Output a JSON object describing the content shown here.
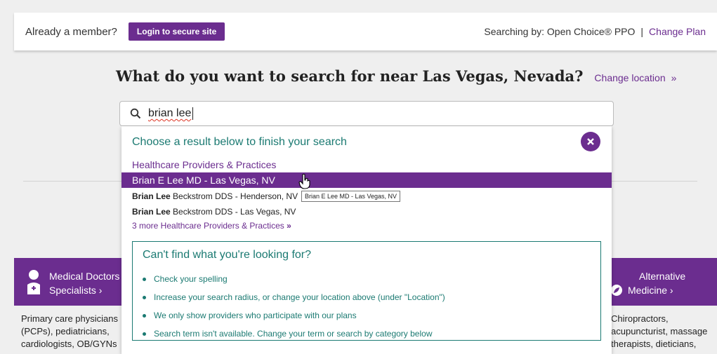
{
  "top_bar": {
    "member_label": "Already a member?",
    "login_button": "Login to secure site",
    "searching_label": "Searching by: Open Choice® PPO",
    "separator": "|",
    "change_plan": "Change Plan"
  },
  "question": {
    "text": "What do you want to search for near Las Vegas, Nevada?",
    "change_location": "Change location",
    "change_location_arrows": "»"
  },
  "search": {
    "value": "brian lee"
  },
  "dropdown": {
    "heading": "Choose a result below to finish your search",
    "section_title": "Healthcare Providers & Practices",
    "highlighted_result": "Brian E Lee MD - Las Vegas, NV",
    "results": [
      {
        "bold": "Brian Lee",
        "rest": " Beckstrom DDS - Henderson, NV"
      },
      {
        "bold": "Brian Lee",
        "rest": " Beckstrom DDS - Las Vegas, NV"
      }
    ],
    "more_link": "3 more Healthcare Providers & Practices",
    "more_arrows": "»",
    "tooltip": "Brian E Lee MD - Las Vegas, NV"
  },
  "help": {
    "title": "Can't find what you're looking for?",
    "items": [
      "Check your spelling",
      "Increase your search radius, or change your location above (under \"Location\")",
      "We only show providers who participate with our plans",
      "Search term isn't available. Change your term or search by category below"
    ]
  },
  "categories": {
    "left_line1": "Medical Doctors",
    "left_line2": "Specialists ›",
    "left_desc": [
      "Primary care physicians",
      "(PCPs), pediatricians,",
      "cardiologists, OB/GYNs"
    ],
    "right_line1": "Alternative",
    "right_line2": "Medicine ›",
    "right_desc": [
      "Chiropractors,",
      "acupuncturist, massage",
      "therapists, dieticians,"
    ]
  },
  "colors": {
    "brand_purple": "#6b2d8f",
    "teal": "#1b7a72"
  }
}
